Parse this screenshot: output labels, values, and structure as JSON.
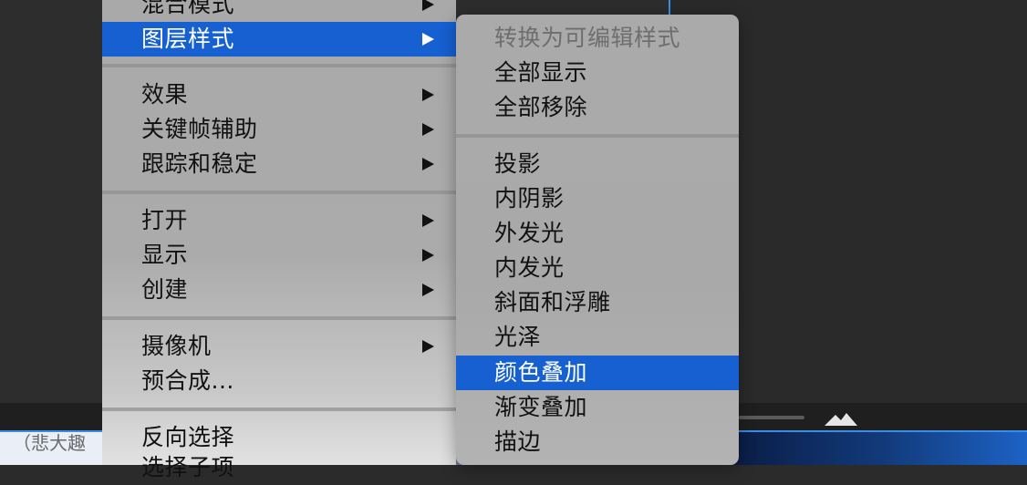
{
  "background": {
    "bottom_text": "（悲大趣"
  },
  "main_menu": {
    "items": [
      {
        "label": "混合模式",
        "has_submenu": true,
        "state": "normal"
      },
      {
        "label": "图层样式",
        "has_submenu": true,
        "state": "selected"
      },
      {
        "label": "效果",
        "has_submenu": true,
        "state": "normal"
      },
      {
        "label": "关键帧辅助",
        "has_submenu": true,
        "state": "normal"
      },
      {
        "label": "跟踪和稳定",
        "has_submenu": true,
        "state": "normal"
      },
      {
        "label": "打开",
        "has_submenu": true,
        "state": "normal"
      },
      {
        "label": "显示",
        "has_submenu": true,
        "state": "normal"
      },
      {
        "label": "创建",
        "has_submenu": true,
        "state": "normal"
      },
      {
        "label": "摄像机",
        "has_submenu": true,
        "state": "normal"
      },
      {
        "label": "预合成...",
        "has_submenu": false,
        "state": "normal"
      },
      {
        "label": "反向选择",
        "has_submenu": false,
        "state": "normal"
      },
      {
        "label": "选择子项",
        "has_submenu": false,
        "state": "normal"
      }
    ]
  },
  "sub_menu": {
    "items": [
      {
        "label": "转换为可编辑样式",
        "state": "disabled"
      },
      {
        "label": "全部显示",
        "state": "normal"
      },
      {
        "label": "全部移除",
        "state": "normal"
      },
      {
        "label": "投影",
        "state": "normal"
      },
      {
        "label": "内阴影",
        "state": "normal"
      },
      {
        "label": "外发光",
        "state": "normal"
      },
      {
        "label": "内发光",
        "state": "normal"
      },
      {
        "label": "斜面和浮雕",
        "state": "normal"
      },
      {
        "label": "光泽",
        "state": "normal"
      },
      {
        "label": "颜色叠加",
        "state": "selected"
      },
      {
        "label": "渐变叠加",
        "state": "normal"
      },
      {
        "label": "描边",
        "state": "normal"
      }
    ]
  },
  "colors": {
    "highlight": "#1660d2",
    "menu_bg": "#a9a9a9",
    "disabled_text": "#6e6e6e"
  },
  "icons": {
    "submenu_arrow": "triangle-right-icon",
    "mountain": "mountain-icon"
  }
}
